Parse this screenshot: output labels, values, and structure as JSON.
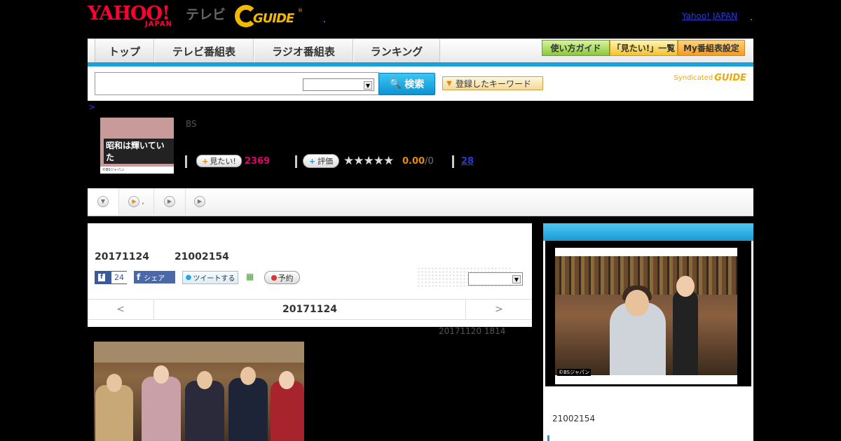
{
  "header": {
    "logo_text": "YAHOO!",
    "logo_sub": "JAPAN",
    "tv_label": "テレビ",
    "gguide_text": "GUIDE",
    "gguide_mark": "®",
    "yahoo_link": "Yahoo! JAPAN"
  },
  "nav": {
    "tabs": [
      {
        "label": "トップ"
      },
      {
        "label": "テレビ番組表"
      },
      {
        "label": "ラジオ番組表"
      },
      {
        "label": "ランキング"
      }
    ],
    "buttons": [
      {
        "label": "使い方ガイド"
      },
      {
        "label": "「見たい!」一覧"
      },
      {
        "label": "My番組表設定"
      }
    ]
  },
  "search": {
    "input_value": "",
    "select_value": "",
    "button_label": "検索",
    "keyword_button": "登録したキーワード",
    "syndicated": "Syndicated",
    "syndicated_logo": "GUIDE"
  },
  "breadcrumb": ">",
  "program": {
    "thumb_title": "昭和は輝いていた",
    "thumb_copy": "©BSジャパン",
    "channel": "BS",
    "mitai_label": "見たい!",
    "mitai_count": "2369",
    "hyoka_label": "評価",
    "rating": 0,
    "score": "0.00",
    "score_sep": "/0",
    "review_count": "28"
  },
  "subtabs": [
    {
      "label": ""
    },
    {
      "label": ","
    },
    {
      "label": ""
    },
    {
      "label": ""
    }
  ],
  "broadcast": {
    "date": "20171124",
    "time": "21002154",
    "fb_count": "24",
    "share_label": "シェア",
    "tweet_label": "ツイートする",
    "reserve_label": "予約",
    "dropdown_value": ""
  },
  "date_nav": {
    "prev": "<",
    "current": "20171124",
    "next": ">"
  },
  "updated": "20171120  1814",
  "sidebar": {
    "image_caption": "©BSジャパン",
    "time": "21002154"
  }
}
